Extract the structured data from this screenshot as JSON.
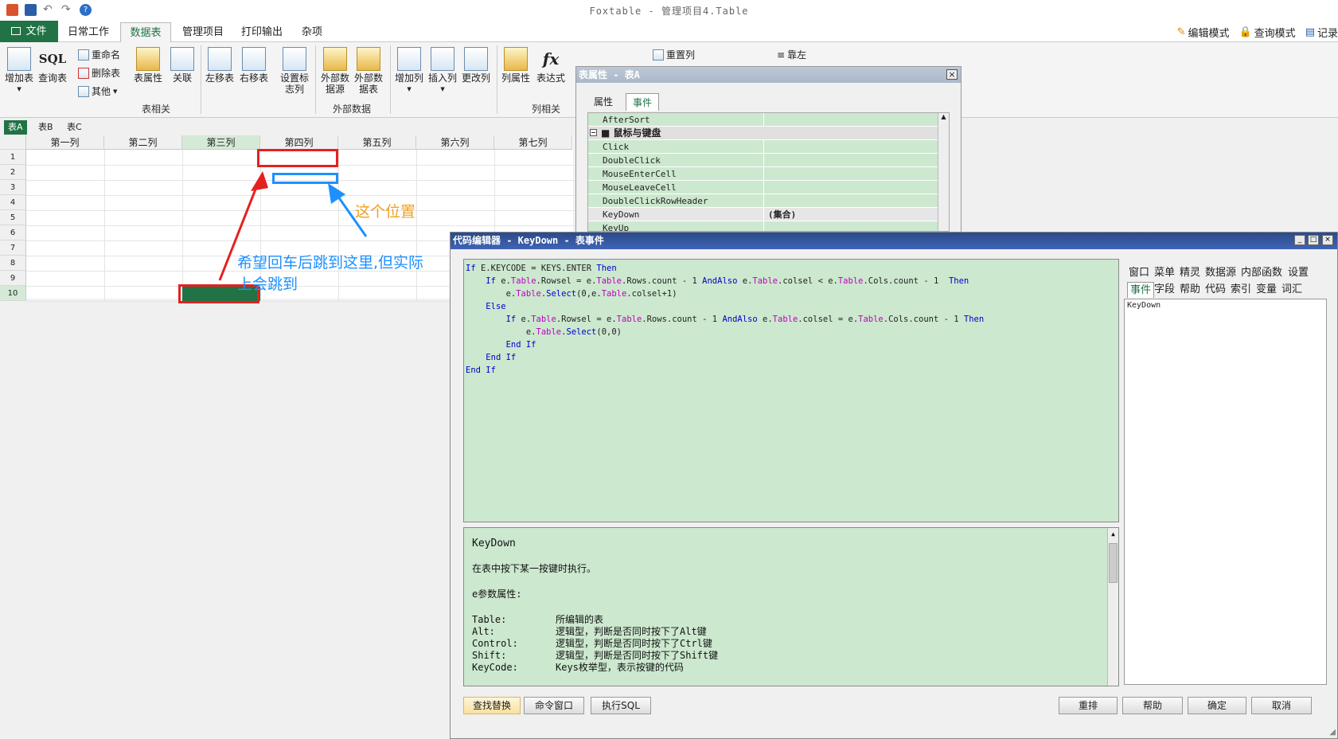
{
  "app_title": "Foxtable - 管理项目4.Table",
  "menu": {
    "file": "文件",
    "daily": "日常工作",
    "datatable": "数据表",
    "manage": "管理项目",
    "print": "打印输出",
    "misc": "杂项"
  },
  "modes": {
    "edit": "编辑模式",
    "query": "查询模式",
    "record": "记录"
  },
  "ribbon": {
    "add_table": "增加表",
    "sql_label": "SQL",
    "query_table": "查询表",
    "rename": "重命名",
    "delete_table": "删除表",
    "other": "其他",
    "table_props": "表属性",
    "relation": "关联",
    "move_left": "左移表",
    "move_right": "右移表",
    "set_flag_col": "设置标志列",
    "ext_src1": "外部数据源",
    "ext_src2": "外部数据表",
    "add_col": "增加列",
    "insert_col": "插入列",
    "change_col": "更改列",
    "col_props": "列属性",
    "expr_col": "表达式",
    "reset_col": "重置列",
    "align_left": "靠左",
    "group_table": "表相关",
    "group_ext": "外部数据",
    "group_col": "列相关"
  },
  "sheets": [
    "表A",
    "表B",
    "表C"
  ],
  "grid": {
    "cols": [
      "第一列",
      "第二列",
      "第三列",
      "第四列",
      "第五列",
      "第六列",
      "第七列"
    ],
    "rows": [
      "1",
      "2",
      "3",
      "4",
      "5",
      "6",
      "7",
      "8",
      "9",
      "10"
    ]
  },
  "annotations": {
    "target_label": "这个位置",
    "desc_line1": "希望回车后跳到这里,但实际",
    "desc_line2": "上会跳到"
  },
  "props": {
    "title": "表属性 - 表A",
    "tab_props": "属性",
    "tab_events": "事件",
    "rows": [
      {
        "name": "AfterSort",
        "value": ""
      },
      {
        "name": "鼠标与键盘",
        "value": "",
        "group": true
      },
      {
        "name": "Click",
        "value": ""
      },
      {
        "name": "DoubleClick",
        "value": ""
      },
      {
        "name": "MouseEnterCell",
        "value": ""
      },
      {
        "name": "MouseLeaveCell",
        "value": ""
      },
      {
        "name": "DoubleClickRowHeader",
        "value": ""
      },
      {
        "name": "KeyDown",
        "value": "(集合)"
      },
      {
        "name": "KeyUp",
        "value": ""
      }
    ]
  },
  "editor": {
    "title": "代码编辑器 - KeyDown - 表事件",
    "side_tabs_row1": [
      "窗口",
      "菜单",
      "精灵",
      "数据源",
      "内部函数",
      "设置"
    ],
    "side_tabs_row2": [
      "事件",
      "字段",
      "帮助",
      "代码",
      "索引",
      "变量",
      "词汇"
    ],
    "side_list": [
      "KeyDown"
    ],
    "help_title": "KeyDown",
    "help_desc": "在表中按下某一按键时执行。",
    "help_params_title": "e参数属性:",
    "help_params": [
      {
        "k": "Table:",
        "v": "所编辑的表"
      },
      {
        "k": "Alt:",
        "v": "逻辑型，判断是否同时按下了Alt键"
      },
      {
        "k": "Control:",
        "v": "逻辑型，判断是否同时按下了Ctrl键"
      },
      {
        "k": "Shift:",
        "v": "逻辑型，判断是否同时按下了Shift键"
      },
      {
        "k": "KeyCode:",
        "v": "Keys枚举型，表示按键的代码"
      }
    ],
    "buttons_left": [
      "查找替换",
      "命令窗口",
      "执行SQL"
    ],
    "buttons_right": [
      "重排",
      "帮助",
      "确定",
      "取消"
    ]
  }
}
